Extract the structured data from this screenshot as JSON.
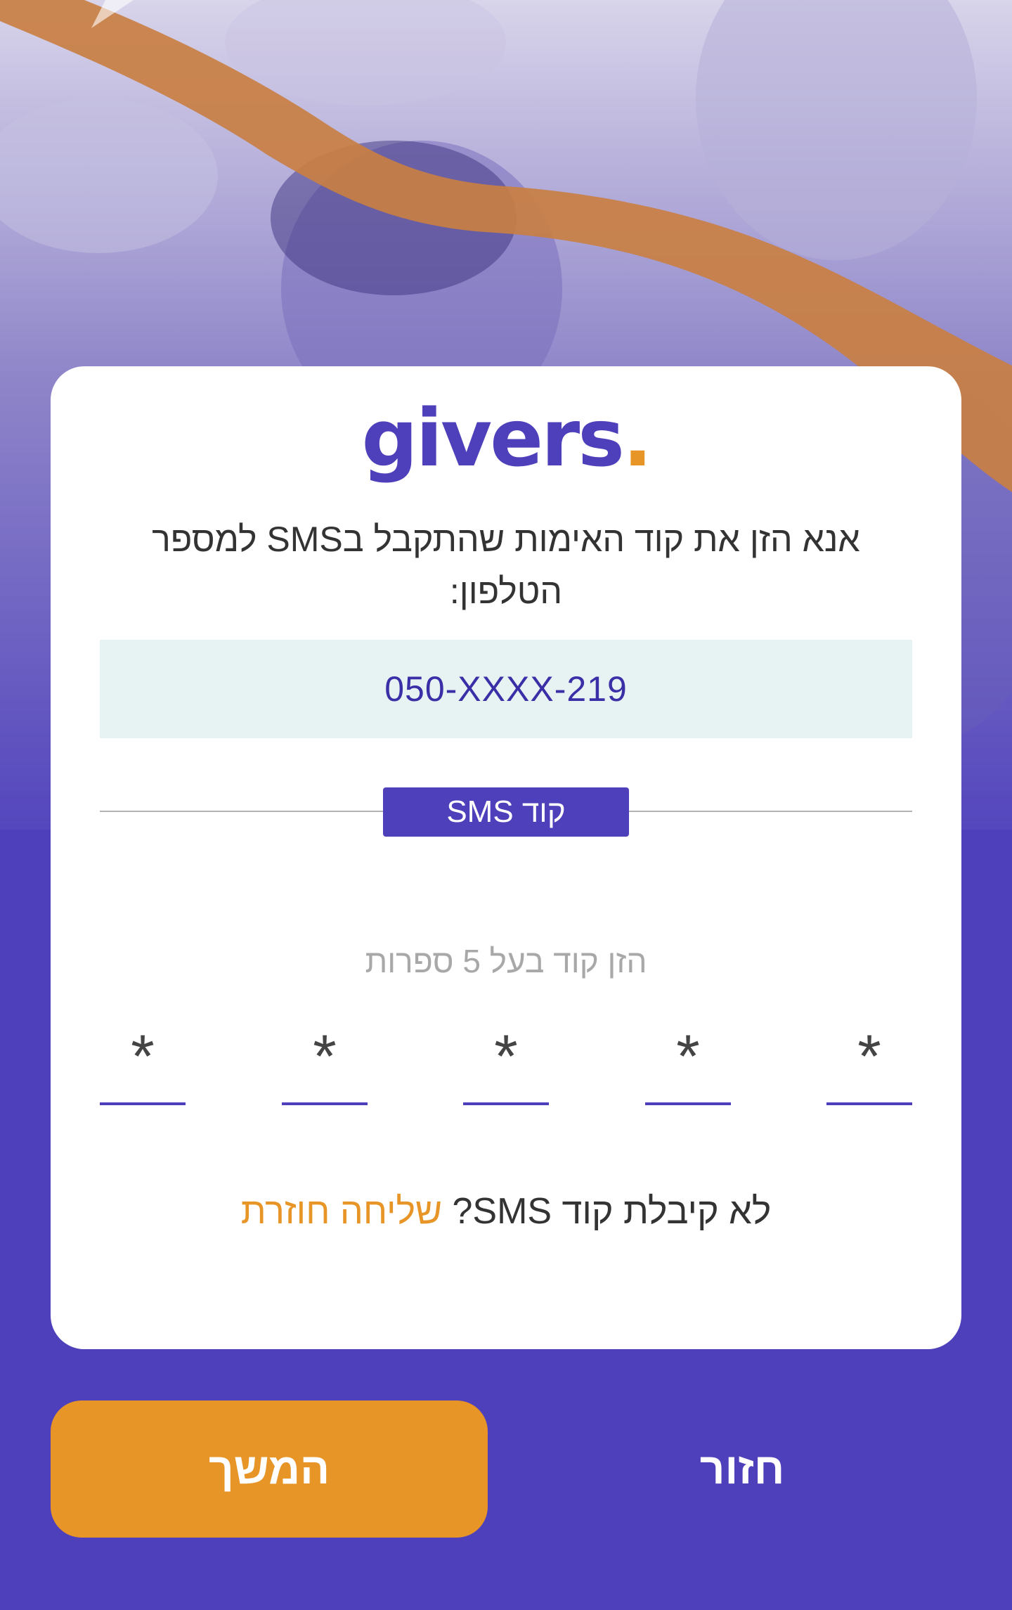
{
  "colors": {
    "brand_purple": "#4e3fbb",
    "accent_orange": "#e89527",
    "phone_box_bg": "#e6f3f2",
    "phone_text": "#3b2fa8"
  },
  "hero": {
    "image": "family-photo-with-orange-brush-stroke"
  },
  "logo": {
    "text": "givers",
    "dot": "."
  },
  "instruction": {
    "line1": "אנא הזן את קוד האימות שהתקבל בSMS למספר",
    "line2": "הטלפון:"
  },
  "phone": {
    "masked_number": "050-XXXX-219"
  },
  "sms_section": {
    "label": "קוד SMS"
  },
  "code_input": {
    "hint": "הזן קוד בעל 5 ספרות",
    "digits": [
      "*",
      "*",
      "*",
      "*",
      "*"
    ]
  },
  "resend": {
    "question": "לא קיבלת קוד SMS?",
    "link": "שליחה חוזרת"
  },
  "actions": {
    "continue_label": "המשך",
    "back_label": "חזור"
  }
}
